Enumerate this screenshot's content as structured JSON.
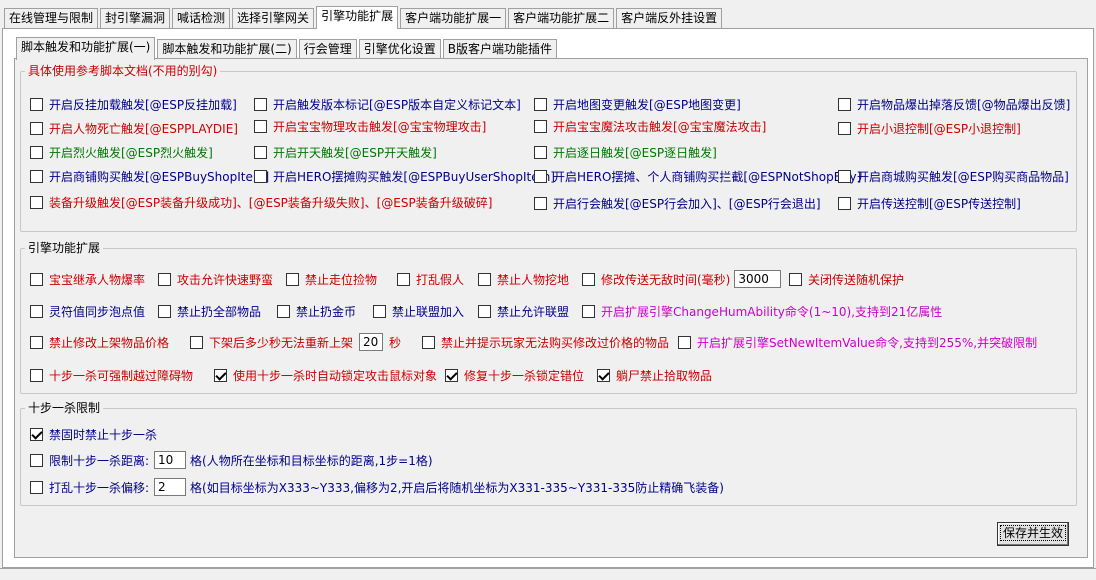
{
  "top_tabs": [
    "在线管理与限制",
    "封引擎漏洞",
    "喊话检测",
    "选择引擎网关",
    "引擎功能扩展",
    "客户端功能扩展一",
    "客户端功能扩展二",
    "客户端反外挂设置"
  ],
  "sub_tabs": [
    "脚本触发和功能扩展(一)",
    "脚本触发和功能扩展(二)",
    "行会管理",
    "引擎优化设置",
    "B版客户端功能插件"
  ],
  "group1": {
    "title": "具体使用参考脚本文档(不用的别勾)",
    "items": [
      {
        "label": "开启反挂加载触发[@ESP反挂加载]",
        "checked": false,
        "color": "blue"
      },
      {
        "label": "开启触发版本标记[@ESP版本自定义标记文本]",
        "checked": false,
        "color": "blue"
      },
      {
        "label": "开启地图变更触发[@ESP地图变更]",
        "checked": false,
        "color": "blue"
      },
      {
        "label": "开启物品爆出掉落反馈[@物品爆出反馈]",
        "checked": false,
        "color": "blue"
      },
      {
        "label": "开启人物死亡触发[@ESPPLAYDIE]",
        "checked": false,
        "color": "red"
      },
      {
        "label": "开启宝宝物理攻击触发[@宝宝物理攻击]",
        "checked": false,
        "color": "red"
      },
      {
        "label": "开启宝宝魔法攻击触发[@宝宝魔法攻击]",
        "checked": false,
        "color": "red"
      },
      {
        "label": "开启小退控制[@ESP小退控制]",
        "checked": false,
        "color": "red"
      },
      {
        "label": "开启烈火触发[@ESP烈火触发]",
        "checked": false,
        "color": "green"
      },
      {
        "label": "开启开天触发[@ESP开天触发]",
        "checked": false,
        "color": "green"
      },
      {
        "label": "开启逐日触发[@ESP逐日触发]",
        "checked": false,
        "color": "green"
      },
      {
        "label": "开启商铺购买触发[@ESPBuyShopItem]",
        "checked": false,
        "color": "blue"
      },
      {
        "label": "开启HERO摆摊购买触发[@ESPBuyUserShopItem]",
        "checked": false,
        "color": "blue"
      },
      {
        "label": "开启HERO摆摊、个人商铺购买拦截[@ESPNotShopBuy]",
        "checked": false,
        "color": "blue"
      },
      {
        "label": "开启商城购买触发[@ESP购买商品物品]",
        "checked": false,
        "color": "blue"
      },
      {
        "label": "装备升级触发[@ESP装备升级成功]、[@ESP装备升级失败]、[@ESP装备升级破碎]",
        "checked": false,
        "color": "red"
      },
      {
        "label": "开启行会触发[@ESP行会加入]、[@ESP行会退出]",
        "checked": false,
        "color": "blue"
      },
      {
        "label": "开启传送控制[@ESP传送控制]",
        "checked": false,
        "color": "blue"
      }
    ]
  },
  "group2": {
    "title": "引擎功能扩展",
    "row1": [
      {
        "label": "宝宝继承人物爆率",
        "checked": false,
        "color": "red"
      },
      {
        "label": "攻击允许快速野蛮",
        "checked": false,
        "color": "red"
      },
      {
        "label": "禁止走位捡物",
        "checked": false,
        "color": "red"
      },
      {
        "label": "打乱假人",
        "checked": false,
        "color": "red"
      },
      {
        "label": "禁止人物挖地",
        "checked": false,
        "color": "red"
      },
      {
        "label": "修改传送无敌时间(毫秒)",
        "checked": false,
        "color": "red",
        "value": "3000"
      },
      {
        "label": "关闭传送随机保护",
        "checked": false,
        "color": "red"
      }
    ],
    "row2": [
      {
        "label": "灵符值同步泡点值",
        "checked": false,
        "color": "blue"
      },
      {
        "label": "禁止扔全部物品",
        "checked": false,
        "color": "blue"
      },
      {
        "label": "禁止扔金币",
        "checked": false,
        "color": "blue"
      },
      {
        "label": "禁止联盟加入",
        "checked": false,
        "color": "blue"
      },
      {
        "label": "禁止允许联盟",
        "checked": false,
        "color": "blue"
      },
      {
        "label": "开启扩展引擎ChangeHumAbility命令(1~10),支持到21亿属性",
        "checked": false,
        "color": "magenta"
      }
    ],
    "row3": [
      {
        "label": "禁止修改上架物品价格",
        "checked": false,
        "color": "red"
      },
      {
        "label": "下架后多少秒无法重新上架",
        "checked": false,
        "color": "red",
        "value": "20",
        "suffix": "秒"
      },
      {
        "label": "禁止并提示玩家无法购买修改过价格的物品",
        "checked": false,
        "color": "red"
      },
      {
        "label": "开启扩展引擎SetNewItemValue命令,支持到255%,并突破限制",
        "checked": false,
        "color": "magenta"
      }
    ],
    "row4": [
      {
        "label": "十步一杀可强制越过障碍物",
        "checked": false,
        "color": "red"
      },
      {
        "label": "使用十步一杀时自动锁定攻击鼠标对象",
        "checked": true,
        "color": "red"
      },
      {
        "label": "修复十步一杀锁定错位",
        "checked": true,
        "color": "red"
      },
      {
        "label": "躺尸禁止拾取物品",
        "checked": true,
        "color": "red"
      }
    ]
  },
  "group3": {
    "title": "十步一杀限制",
    "items": [
      {
        "label": "禁固时禁止十步一杀",
        "checked": true,
        "color": "blue"
      },
      {
        "label": "限制十步一杀距离:",
        "checked": false,
        "color": "blue",
        "value": "10",
        "suffix": "格(人物所在坐标和目标坐标的距离,1步=1格)"
      },
      {
        "label": "打乱十步一杀偏移:",
        "checked": false,
        "color": "blue",
        "value": "2",
        "suffix": "格(如目标坐标为X333~Y333,偏移为2,开启后将随机坐标为X331-335~Y331-335防止精确飞装备)"
      }
    ]
  },
  "save_button": "保存并生效"
}
